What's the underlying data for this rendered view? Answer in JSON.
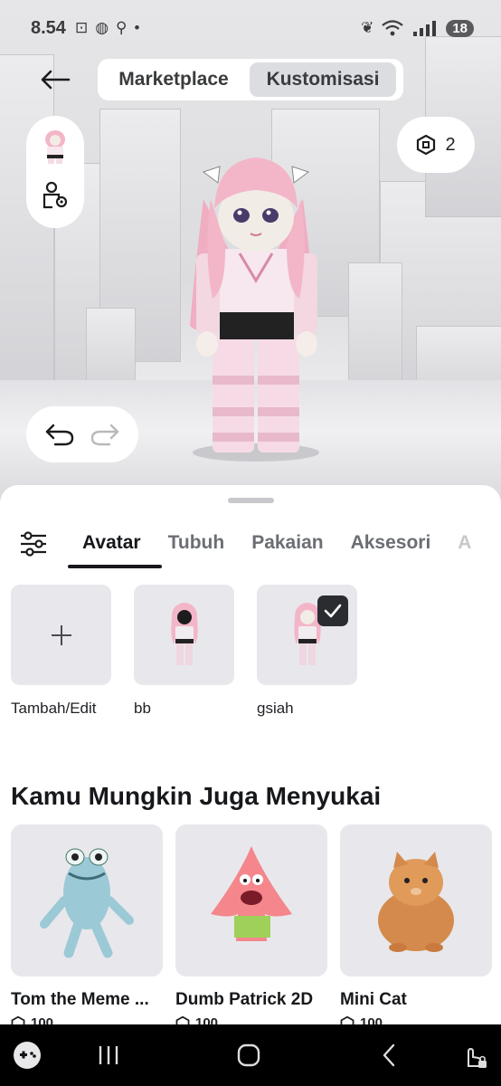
{
  "status_bar": {
    "time": "8.54",
    "battery": "18",
    "left_icons": [
      "screenshot-icon",
      "messenger-icon",
      "add-person-icon",
      "dot-icon"
    ],
    "right_icons": [
      "leaf-icon",
      "wifi-icon",
      "signal-icon"
    ]
  },
  "header": {
    "tabs": [
      {
        "label": "Marketplace",
        "selected": false
      },
      {
        "label": "Kustomisasi",
        "selected": true
      }
    ]
  },
  "robux": {
    "count": "2"
  },
  "category_tabs": [
    {
      "label": "Avatar",
      "active": true
    },
    {
      "label": "Tubuh",
      "active": false
    },
    {
      "label": "Pakaian",
      "active": false
    },
    {
      "label": "Aksesori",
      "active": false
    },
    {
      "label": "A",
      "active": false
    }
  ],
  "outfits": [
    {
      "label": "Tambah/Edit",
      "type": "add"
    },
    {
      "label": "bb",
      "type": "outfit",
      "selected": false
    },
    {
      "label": "gsiah",
      "type": "outfit",
      "selected": true
    }
  ],
  "recommendations": {
    "title": "Kamu Mungkin Juga Menyukai",
    "items": [
      {
        "name": "Tom the Meme ...",
        "price": "100"
      },
      {
        "name": "Dumb Patrick 2D",
        "price": "100"
      },
      {
        "name": "Mini Cat",
        "price": "100"
      }
    ]
  },
  "colors": {
    "accent": "#16181b",
    "selected_tab_bg": "#dcdde1",
    "tile_bg": "#e8e8ec",
    "avatar_hair": "#f3b6c8"
  }
}
